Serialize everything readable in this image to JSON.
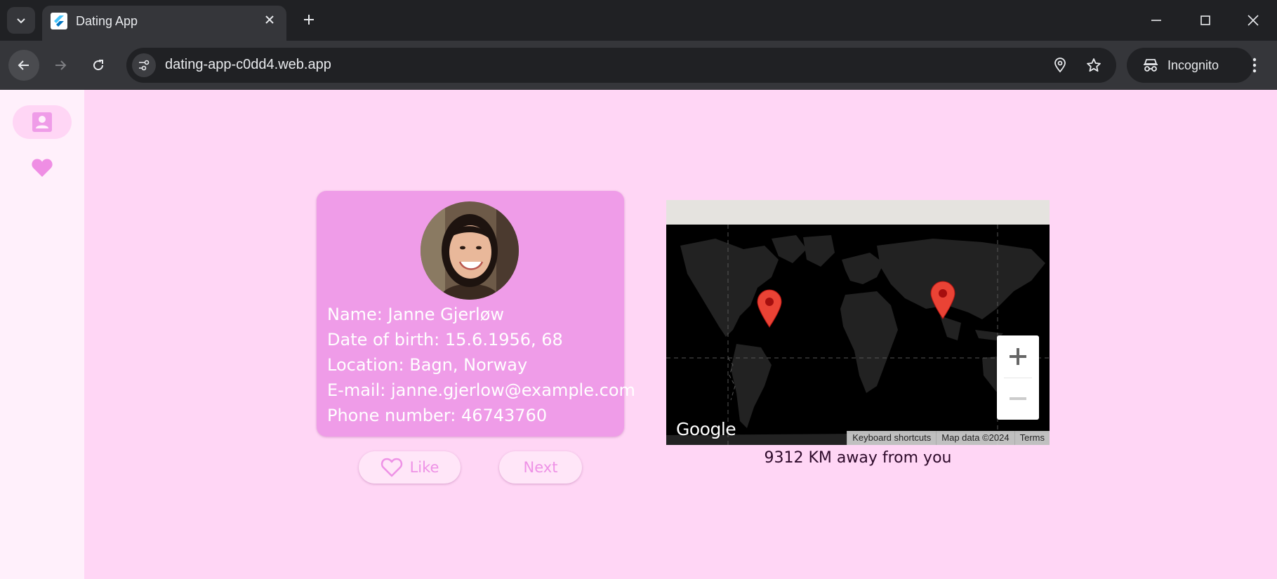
{
  "browser": {
    "tab_title": "Dating App",
    "url": "dating-app-c0dd4.web.app",
    "profile_label": "Incognito"
  },
  "rail": {
    "items": [
      {
        "icon": "person-card-icon",
        "active": true
      },
      {
        "icon": "heart-icon",
        "active": false
      }
    ]
  },
  "profile": {
    "name_label": "Name:",
    "name": "Janne Gjerløw",
    "dob_label": "Date of birth:",
    "dob": "15.6.1956, 68",
    "location_label": "Location:",
    "location": "Bagn, Norway",
    "email_label": "E-mail:",
    "email": "janne.gjerlow@example.com",
    "phone_label": "Phone number:",
    "phone": "46743760"
  },
  "actions": {
    "like_label": "Like",
    "next_label": "Next"
  },
  "map": {
    "logo": "Google",
    "attribution": [
      "Keyboard shortcuts",
      "Map data ©2024",
      "Terms"
    ],
    "zoom_in": "+",
    "zoom_out": "−",
    "markers": 2
  },
  "distance_text": "9312 KM away from you",
  "colors": {
    "page_bg": "#ffd6f5",
    "rail_bg": "#fff0fb",
    "card_bg": "#ef9ce8",
    "accent": "#ee92e6",
    "marker": "#ea4335"
  }
}
